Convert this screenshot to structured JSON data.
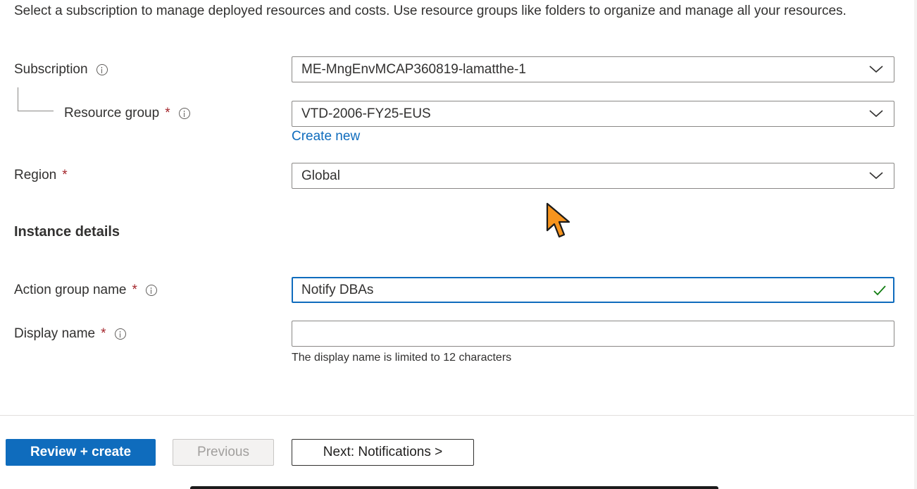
{
  "intro_text": "Select a subscription to manage deployed resources and costs. Use resource groups like folders to organize and manage all your resources.",
  "subscription": {
    "label": "Subscription",
    "value": "ME-MngEnvMCAP360819-lamatthe-1"
  },
  "resource_group": {
    "label": "Resource group",
    "required_mark": "*",
    "value": "VTD-2006-FY25-EUS",
    "create_new_label": "Create new"
  },
  "region": {
    "label": "Region",
    "required_mark": "*",
    "value": "Global"
  },
  "instance_details": {
    "heading": "Instance details"
  },
  "action_group_name": {
    "label": "Action group name",
    "required_mark": "*",
    "value": "Notify DBAs"
  },
  "display_name": {
    "label": "Display name",
    "required_mark": "*",
    "value": "",
    "help_text": "The display name is limited to 12 characters"
  },
  "footer": {
    "review_create_label": "Review + create",
    "previous_label": "Previous",
    "next_label": "Next: Notifications >"
  },
  "colors": {
    "accent": "#0f6cbd",
    "required": "#a4262c",
    "valid_check": "#107c10",
    "cursor": "#f7941d"
  },
  "icons": [
    "info-icon",
    "chevron-down-icon",
    "checkmark-icon",
    "mouse-cursor-icon"
  ]
}
